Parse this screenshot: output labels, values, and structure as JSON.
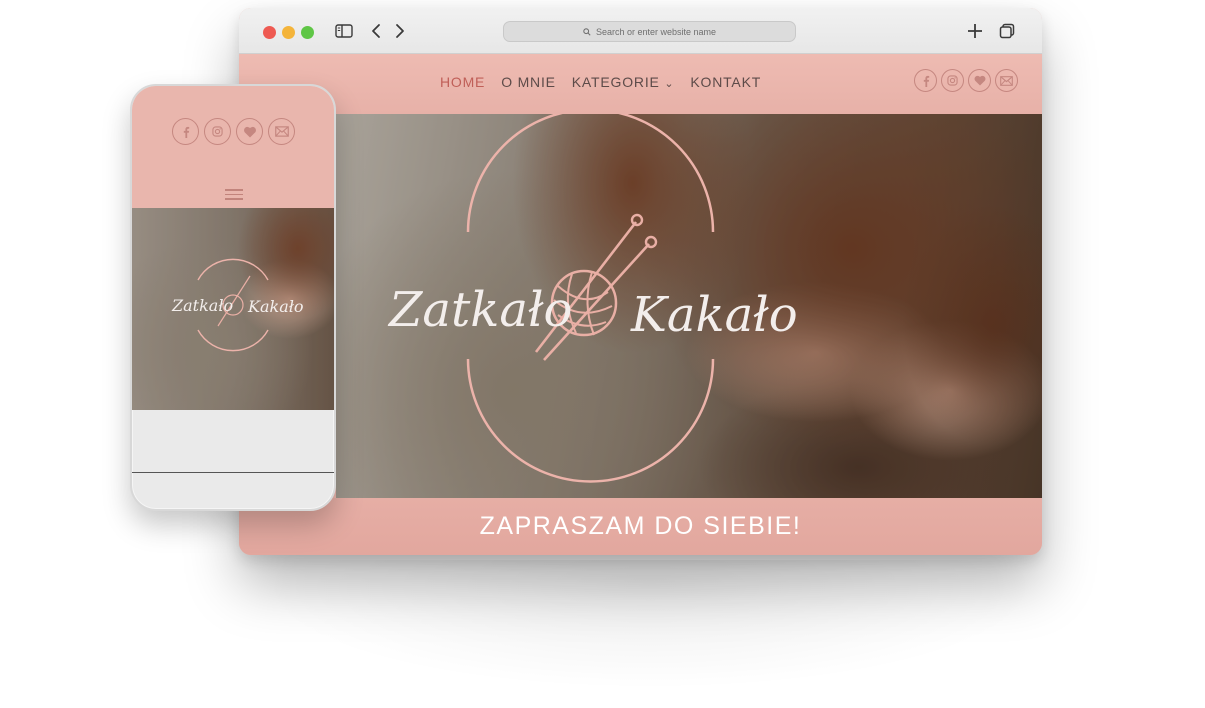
{
  "browser": {
    "address_placeholder": "Search or enter website name"
  },
  "site": {
    "nav": {
      "home": "HOME",
      "about": "O MNIE",
      "categories": "KATEGORIE",
      "categories_caret": "⌄",
      "contact": "KONTAKT"
    },
    "social": [
      "facebook-icon",
      "instagram-icon",
      "heart-icon",
      "mail-icon"
    ],
    "logo": {
      "left_word": "Zatkało",
      "right_word": "Kakało"
    },
    "tagline": "ZAPRASZAM DO SIEBIE!"
  },
  "phone": {
    "logo": {
      "left_word": "Zatkało",
      "right_word": "Kakało"
    }
  },
  "colors": {
    "brand_pink": "#e9b6ad",
    "nav_active": "#c05f58",
    "icon_outline": "#c58780",
    "logo_line": "#ecb3aa"
  }
}
